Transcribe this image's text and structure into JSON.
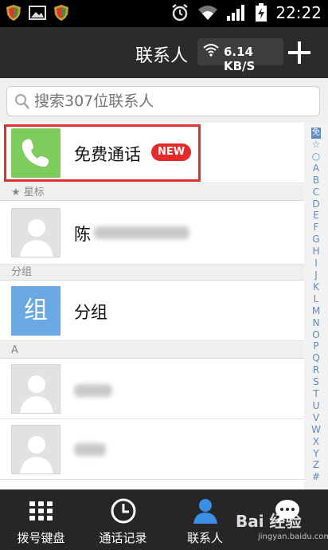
{
  "status_bar": {
    "time": "22:22",
    "icons": [
      "shield-app-icon",
      "image-icon",
      "shield-app-icon",
      "alarm-icon",
      "wifi-icon",
      "signal-icon",
      "battery-charging-icon"
    ]
  },
  "header": {
    "title": "联系人",
    "network_speed": "6.14 KB/S",
    "add_icon": "plus-icon"
  },
  "search": {
    "placeholder": "搜索307位联系人"
  },
  "list": {
    "free_call": {
      "label": "免费通话",
      "badge": "NEW",
      "icon": "phone-icon"
    },
    "starred_section": "★ 星标",
    "starred_contact": {
      "name": "陈"
    },
    "group_section": "分组",
    "group_item": {
      "icon_text": "组",
      "label": "分组"
    },
    "a_section": "A"
  },
  "alphabet_index": [
    "☆",
    "○",
    "A",
    "B",
    "C",
    "D",
    "E",
    "F",
    "G",
    "H",
    "I",
    "J",
    "K",
    "L",
    "M",
    "N",
    "O",
    "P",
    "Q",
    "R",
    "S",
    "T",
    "U",
    "V",
    "W",
    "X",
    "Y",
    "Z",
    "#"
  ],
  "alphabet_fav": "免",
  "bottom_nav": [
    {
      "label": "拨号键盘",
      "icon": "dialpad-icon"
    },
    {
      "label": "通话记录",
      "icon": "clock-icon"
    },
    {
      "label": "联系人",
      "icon": "person-icon"
    },
    {
      "label": "",
      "icon": "chat-icon"
    }
  ],
  "watermark": {
    "main": "Bai 经验",
    "sub": "jingyan.baidu.com"
  },
  "colors": {
    "highlight": "#e03030",
    "free_call_icon": "#7dcc5c",
    "group_icon": "#6aa8e6",
    "badge": "#e52a2a",
    "active_tab": "#3a8ee6"
  }
}
